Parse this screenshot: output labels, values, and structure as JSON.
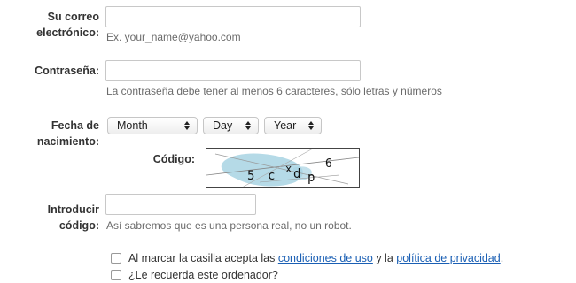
{
  "email": {
    "label_line1": "Su correo",
    "label_line2": "electrónico:",
    "value": "",
    "hint": "Ex. your_name@yahoo.com"
  },
  "password": {
    "label": "Contraseña:",
    "value": "",
    "hint": "La contraseña debe tener al menos 6 caracteres, sólo letras y números"
  },
  "birthdate": {
    "label_line1": "Fecha de",
    "label_line2": "nacimiento:",
    "month": "Month",
    "day": "Day",
    "year": "Year"
  },
  "captcha": {
    "label": "Código:",
    "chars": [
      "5",
      "c",
      "x",
      "d",
      "p",
      "6"
    ]
  },
  "code_entry": {
    "label_line1": "Introducir",
    "label_line2": "código:",
    "value": "",
    "hint": "Así sabremos que es una persona real, no un robot."
  },
  "terms": {
    "text_before": "Al marcar la casilla acepta las ",
    "link_terms": "condiciones de uso",
    "text_middle": " y la ",
    "link_privacy": "política de privacidad",
    "text_after": ".",
    "checked": false
  },
  "remember": {
    "text": "¿Le recuerda este ordenador?",
    "checked": false
  },
  "colors": {
    "link": "#1a5fb4",
    "label": "#333333",
    "hint": "#6b6b6b",
    "input_border": "#c8c8c8",
    "captcha_blob": "#a8d3e3"
  }
}
